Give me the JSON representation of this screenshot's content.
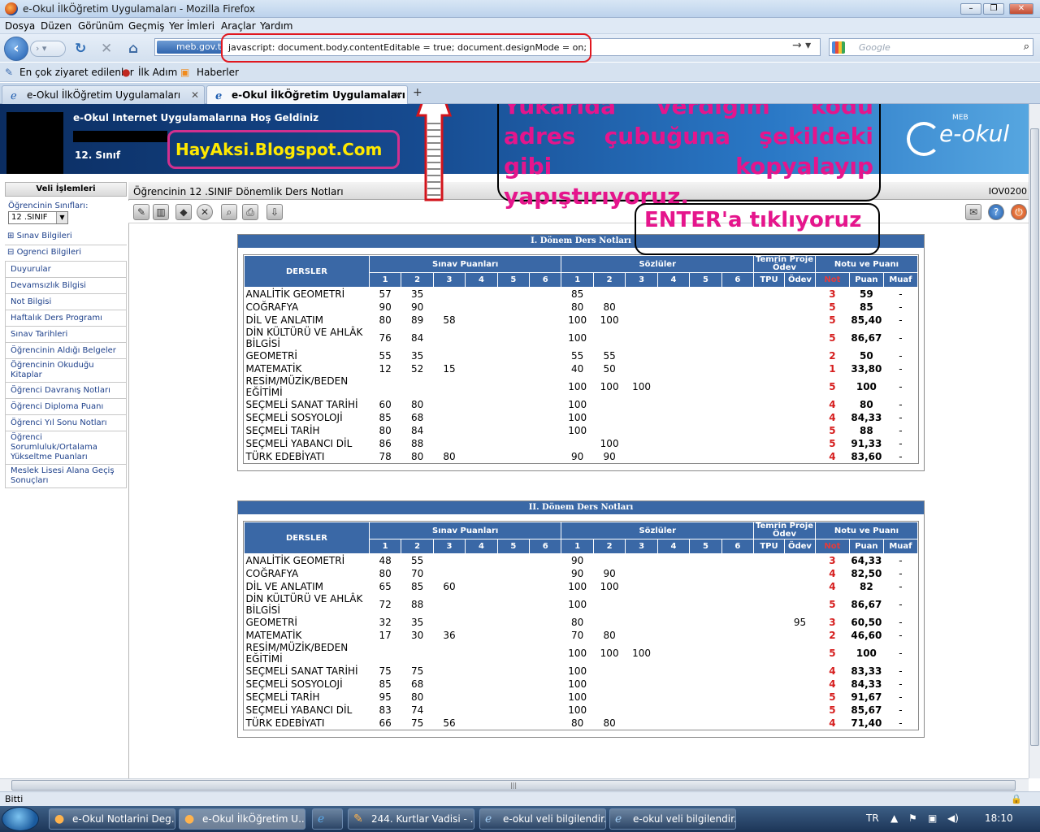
{
  "browser": {
    "window_title": "e-Okul İlkÖğretim Uygulamaları - Mozilla Firefox",
    "menu": [
      "Dosya",
      "Düzen",
      "Görünüm",
      "Geçmiş",
      "Yer İmleri",
      "Araçlar",
      "Yardım"
    ],
    "url_site": "meb.gov.tr",
    "url": "javascript: document.body.contentEditable = true; document.designMode = on;",
    "search_placeholder": "Google",
    "bookmarks": [
      "En çok ziyaret edilenler",
      "İlk Adım",
      "Haberler"
    ],
    "tabs": [
      "e-Okul İlkÖğretim Uygulamaları",
      "e-Okul İlkÖğretim Uygulamaları"
    ],
    "status": "Bitti",
    "accent": "#3a68a6"
  },
  "banner": {
    "welcome": "e-Okul Internet Uygulamalarına Hoş Geldiniz",
    "grade": "12. Sınıf",
    "logo_small": "MEB",
    "logo": "e-okul",
    "blog": "HayAksi.Blogspot.Com"
  },
  "annotations": {
    "callout": "Yukarıda verdiğim kodu adres çubuğuna şekildeki gibi kopyalayıp yapıştırıyoruz.",
    "enter": "ENTER'a tıklıyoruz",
    "color": "#e5158c"
  },
  "sidebar": {
    "header": "Veli İşlemleri",
    "class_label": "Öğrencinin Sınıfları:",
    "class_value": "12 .SINIF",
    "groups": [
      "Sınav Bilgileri",
      "Ogrenci Bilgileri"
    ],
    "items": [
      "Duyurular",
      "Devamsızlık Bilgisi",
      "Not Bilgisi",
      "Haftalık Ders Programı",
      "Sınav Tarihleri",
      "Öğrencinin Aldığı Belgeler",
      "Öğrencinin Okuduğu Kitaplar",
      "Öğrenci Davranış Notları",
      "Öğrenci Diploma Puanı",
      "Öğrenci Yıl Sonu Notları",
      "Öğrenci Sorumluluk/Ortalama Yükseltme Puanları",
      "Meslek Lisesi Alana Geçiş Sonuçları"
    ]
  },
  "page": {
    "title": "Öğrencinin 12 .SINIF Dönemlik Ders Notları",
    "id": "IOV0200"
  },
  "table_headers": {
    "dersler": "DERSLER",
    "sinav": "Sınav Puanları",
    "sozlu": "Sözlüler",
    "temrin": "Temrin Proje Ödev",
    "notu": "Notu ve Puanı",
    "nums": [
      "1",
      "2",
      "3",
      "4",
      "5",
      "6"
    ],
    "tpu": "TPU",
    "odev": "Ödev",
    "not": "Not",
    "puan": "Puan",
    "muaf": "Muaf"
  },
  "terms": [
    {
      "title": "I. Dönem Ders Notları",
      "rows": [
        {
          "ders": "ANALİTİK GEOMETRİ",
          "s": [
            "57",
            "35",
            "",
            "",
            "",
            ""
          ],
          "z": [
            "85",
            "",
            "",
            "",
            "",
            ""
          ],
          "tpu": "",
          "odev": "",
          "not": "3",
          "puan": "59",
          "muaf": "-"
        },
        {
          "ders": "COĞRAFYA",
          "s": [
            "90",
            "90",
            "",
            "",
            "",
            ""
          ],
          "z": [
            "80",
            "80",
            "",
            "",
            "",
            ""
          ],
          "tpu": "",
          "odev": "",
          "not": "5",
          "puan": "85",
          "muaf": "-"
        },
        {
          "ders": "DİL VE ANLATIM",
          "s": [
            "80",
            "89",
            "58",
            "",
            "",
            ""
          ],
          "z": [
            "100",
            "100",
            "",
            "",
            "",
            ""
          ],
          "tpu": "",
          "odev": "",
          "not": "5",
          "puan": "85,40",
          "muaf": "-"
        },
        {
          "ders": "DİN KÜLTÜRÜ VE AHLÂK BİLGİSİ",
          "s": [
            "76",
            "84",
            "",
            "",
            "",
            ""
          ],
          "z": [
            "100",
            "",
            "",
            "",
            "",
            ""
          ],
          "tpu": "",
          "odev": "",
          "not": "5",
          "puan": "86,67",
          "muaf": "-"
        },
        {
          "ders": "GEOMETRİ",
          "s": [
            "55",
            "35",
            "",
            "",
            "",
            ""
          ],
          "z": [
            "55",
            "55",
            "",
            "",
            "",
            ""
          ],
          "tpu": "",
          "odev": "",
          "not": "2",
          "puan": "50",
          "muaf": "-"
        },
        {
          "ders": "MATEMATİK",
          "s": [
            "12",
            "52",
            "15",
            "",
            "",
            ""
          ],
          "z": [
            "40",
            "50",
            "",
            "",
            "",
            ""
          ],
          "tpu": "",
          "odev": "",
          "not": "1",
          "puan": "33,80",
          "muaf": "-"
        },
        {
          "ders": "RESİM/MÜZİK/BEDEN EĞİTİMİ",
          "s": [
            "",
            "",
            "",
            "",
            "",
            ""
          ],
          "z": [
            "100",
            "100",
            "100",
            "",
            "",
            ""
          ],
          "tpu": "",
          "odev": "",
          "not": "5",
          "puan": "100",
          "muaf": "-"
        },
        {
          "ders": "SEÇMELİ SANAT TARİHİ",
          "s": [
            "60",
            "80",
            "",
            "",
            "",
            ""
          ],
          "z": [
            "100",
            "",
            "",
            "",
            "",
            ""
          ],
          "tpu": "",
          "odev": "",
          "not": "4",
          "puan": "80",
          "muaf": "-"
        },
        {
          "ders": "SEÇMELİ SOSYOLOJİ",
          "s": [
            "85",
            "68",
            "",
            "",
            "",
            ""
          ],
          "z": [
            "100",
            "",
            "",
            "",
            "",
            ""
          ],
          "tpu": "",
          "odev": "",
          "not": "4",
          "puan": "84,33",
          "muaf": "-"
        },
        {
          "ders": "SEÇMELİ TARİH",
          "s": [
            "80",
            "84",
            "",
            "",
            "",
            ""
          ],
          "z": [
            "100",
            "",
            "",
            "",
            "",
            ""
          ],
          "tpu": "",
          "odev": "",
          "not": "5",
          "puan": "88",
          "muaf": "-"
        },
        {
          "ders": "SEÇMELİ YABANCI DİL",
          "s": [
            "86",
            "88",
            "",
            "",
            "",
            ""
          ],
          "z": [
            "",
            "100",
            "",
            "",
            "",
            ""
          ],
          "tpu": "",
          "odev": "",
          "not": "5",
          "puan": "91,33",
          "muaf": "-"
        },
        {
          "ders": "TÜRK EDEBİYATI",
          "s": [
            "78",
            "80",
            "80",
            "",
            "",
            ""
          ],
          "z": [
            "90",
            "90",
            "",
            "",
            "",
            ""
          ],
          "tpu": "",
          "odev": "",
          "not": "4",
          "puan": "83,60",
          "muaf": "-"
        }
      ]
    },
    {
      "title": "II. Dönem Ders Notları",
      "rows": [
        {
          "ders": "ANALİTİK GEOMETRİ",
          "s": [
            "48",
            "55",
            "",
            "",
            "",
            ""
          ],
          "z": [
            "90",
            "",
            "",
            "",
            "",
            ""
          ],
          "tpu": "",
          "odev": "",
          "not": "3",
          "puan": "64,33",
          "muaf": "-"
        },
        {
          "ders": "COĞRAFYA",
          "s": [
            "80",
            "70",
            "",
            "",
            "",
            ""
          ],
          "z": [
            "90",
            "90",
            "",
            "",
            "",
            ""
          ],
          "tpu": "",
          "odev": "",
          "not": "4",
          "puan": "82,50",
          "muaf": "-"
        },
        {
          "ders": "DİL VE ANLATIM",
          "s": [
            "65",
            "85",
            "60",
            "",
            "",
            ""
          ],
          "z": [
            "100",
            "100",
            "",
            "",
            "",
            ""
          ],
          "tpu": "",
          "odev": "",
          "not": "4",
          "puan": "82",
          "muaf": "-"
        },
        {
          "ders": "DİN KÜLTÜRÜ VE AHLÂK BİLGİSİ",
          "s": [
            "72",
            "88",
            "",
            "",
            "",
            ""
          ],
          "z": [
            "100",
            "",
            "",
            "",
            "",
            ""
          ],
          "tpu": "",
          "odev": "",
          "not": "5",
          "puan": "86,67",
          "muaf": "-"
        },
        {
          "ders": "GEOMETRİ",
          "s": [
            "32",
            "35",
            "",
            "",
            "",
            ""
          ],
          "z": [
            "80",
            "",
            "",
            "",
            "",
            ""
          ],
          "tpu": "",
          "odev": "95",
          "not": "3",
          "puan": "60,50",
          "muaf": "-"
        },
        {
          "ders": "MATEMATİK",
          "s": [
            "17",
            "30",
            "36",
            "",
            "",
            ""
          ],
          "z": [
            "70",
            "80",
            "",
            "",
            "",
            ""
          ],
          "tpu": "",
          "odev": "",
          "not": "2",
          "puan": "46,60",
          "muaf": "-"
        },
        {
          "ders": "RESİM/MÜZİK/BEDEN EĞİTİMİ",
          "s": [
            "",
            "",
            "",
            "",
            "",
            ""
          ],
          "z": [
            "100",
            "100",
            "100",
            "",
            "",
            ""
          ],
          "tpu": "",
          "odev": "",
          "not": "5",
          "puan": "100",
          "muaf": "-"
        },
        {
          "ders": "SEÇMELİ SANAT TARİHİ",
          "s": [
            "75",
            "75",
            "",
            "",
            "",
            ""
          ],
          "z": [
            "100",
            "",
            "",
            "",
            "",
            ""
          ],
          "tpu": "",
          "odev": "",
          "not": "4",
          "puan": "83,33",
          "muaf": "-"
        },
        {
          "ders": "SEÇMELİ SOSYOLOJİ",
          "s": [
            "85",
            "68",
            "",
            "",
            "",
            ""
          ],
          "z": [
            "100",
            "",
            "",
            "",
            "",
            ""
          ],
          "tpu": "",
          "odev": "",
          "not": "4",
          "puan": "84,33",
          "muaf": "-"
        },
        {
          "ders": "SEÇMELİ TARİH",
          "s": [
            "95",
            "80",
            "",
            "",
            "",
            ""
          ],
          "z": [
            "100",
            "",
            "",
            "",
            "",
            ""
          ],
          "tpu": "",
          "odev": "",
          "not": "5",
          "puan": "91,67",
          "muaf": "-"
        },
        {
          "ders": "SEÇMELİ YABANCI DİL",
          "s": [
            "83",
            "74",
            "",
            "",
            "",
            ""
          ],
          "z": [
            "100",
            "",
            "",
            "",
            "",
            ""
          ],
          "tpu": "",
          "odev": "",
          "not": "5",
          "puan": "85,67",
          "muaf": "-"
        },
        {
          "ders": "TÜRK EDEBİYATI",
          "s": [
            "66",
            "75",
            "56",
            "",
            "",
            ""
          ],
          "z": [
            "80",
            "80",
            "",
            "",
            "",
            ""
          ],
          "tpu": "",
          "odev": "",
          "not": "4",
          "puan": "71,40",
          "muaf": "-"
        }
      ]
    }
  ],
  "taskbar": {
    "tasks": [
      "e-Okul Notlarini Deg...",
      "e-Okul İlkÖğretim U...",
      "",
      "244. Kurtlar Vadisi - ...",
      "e-okul veli bilgilendir...",
      "e-okul veli bilgilendir..."
    ],
    "lang": "TR",
    "time": "18:10"
  }
}
